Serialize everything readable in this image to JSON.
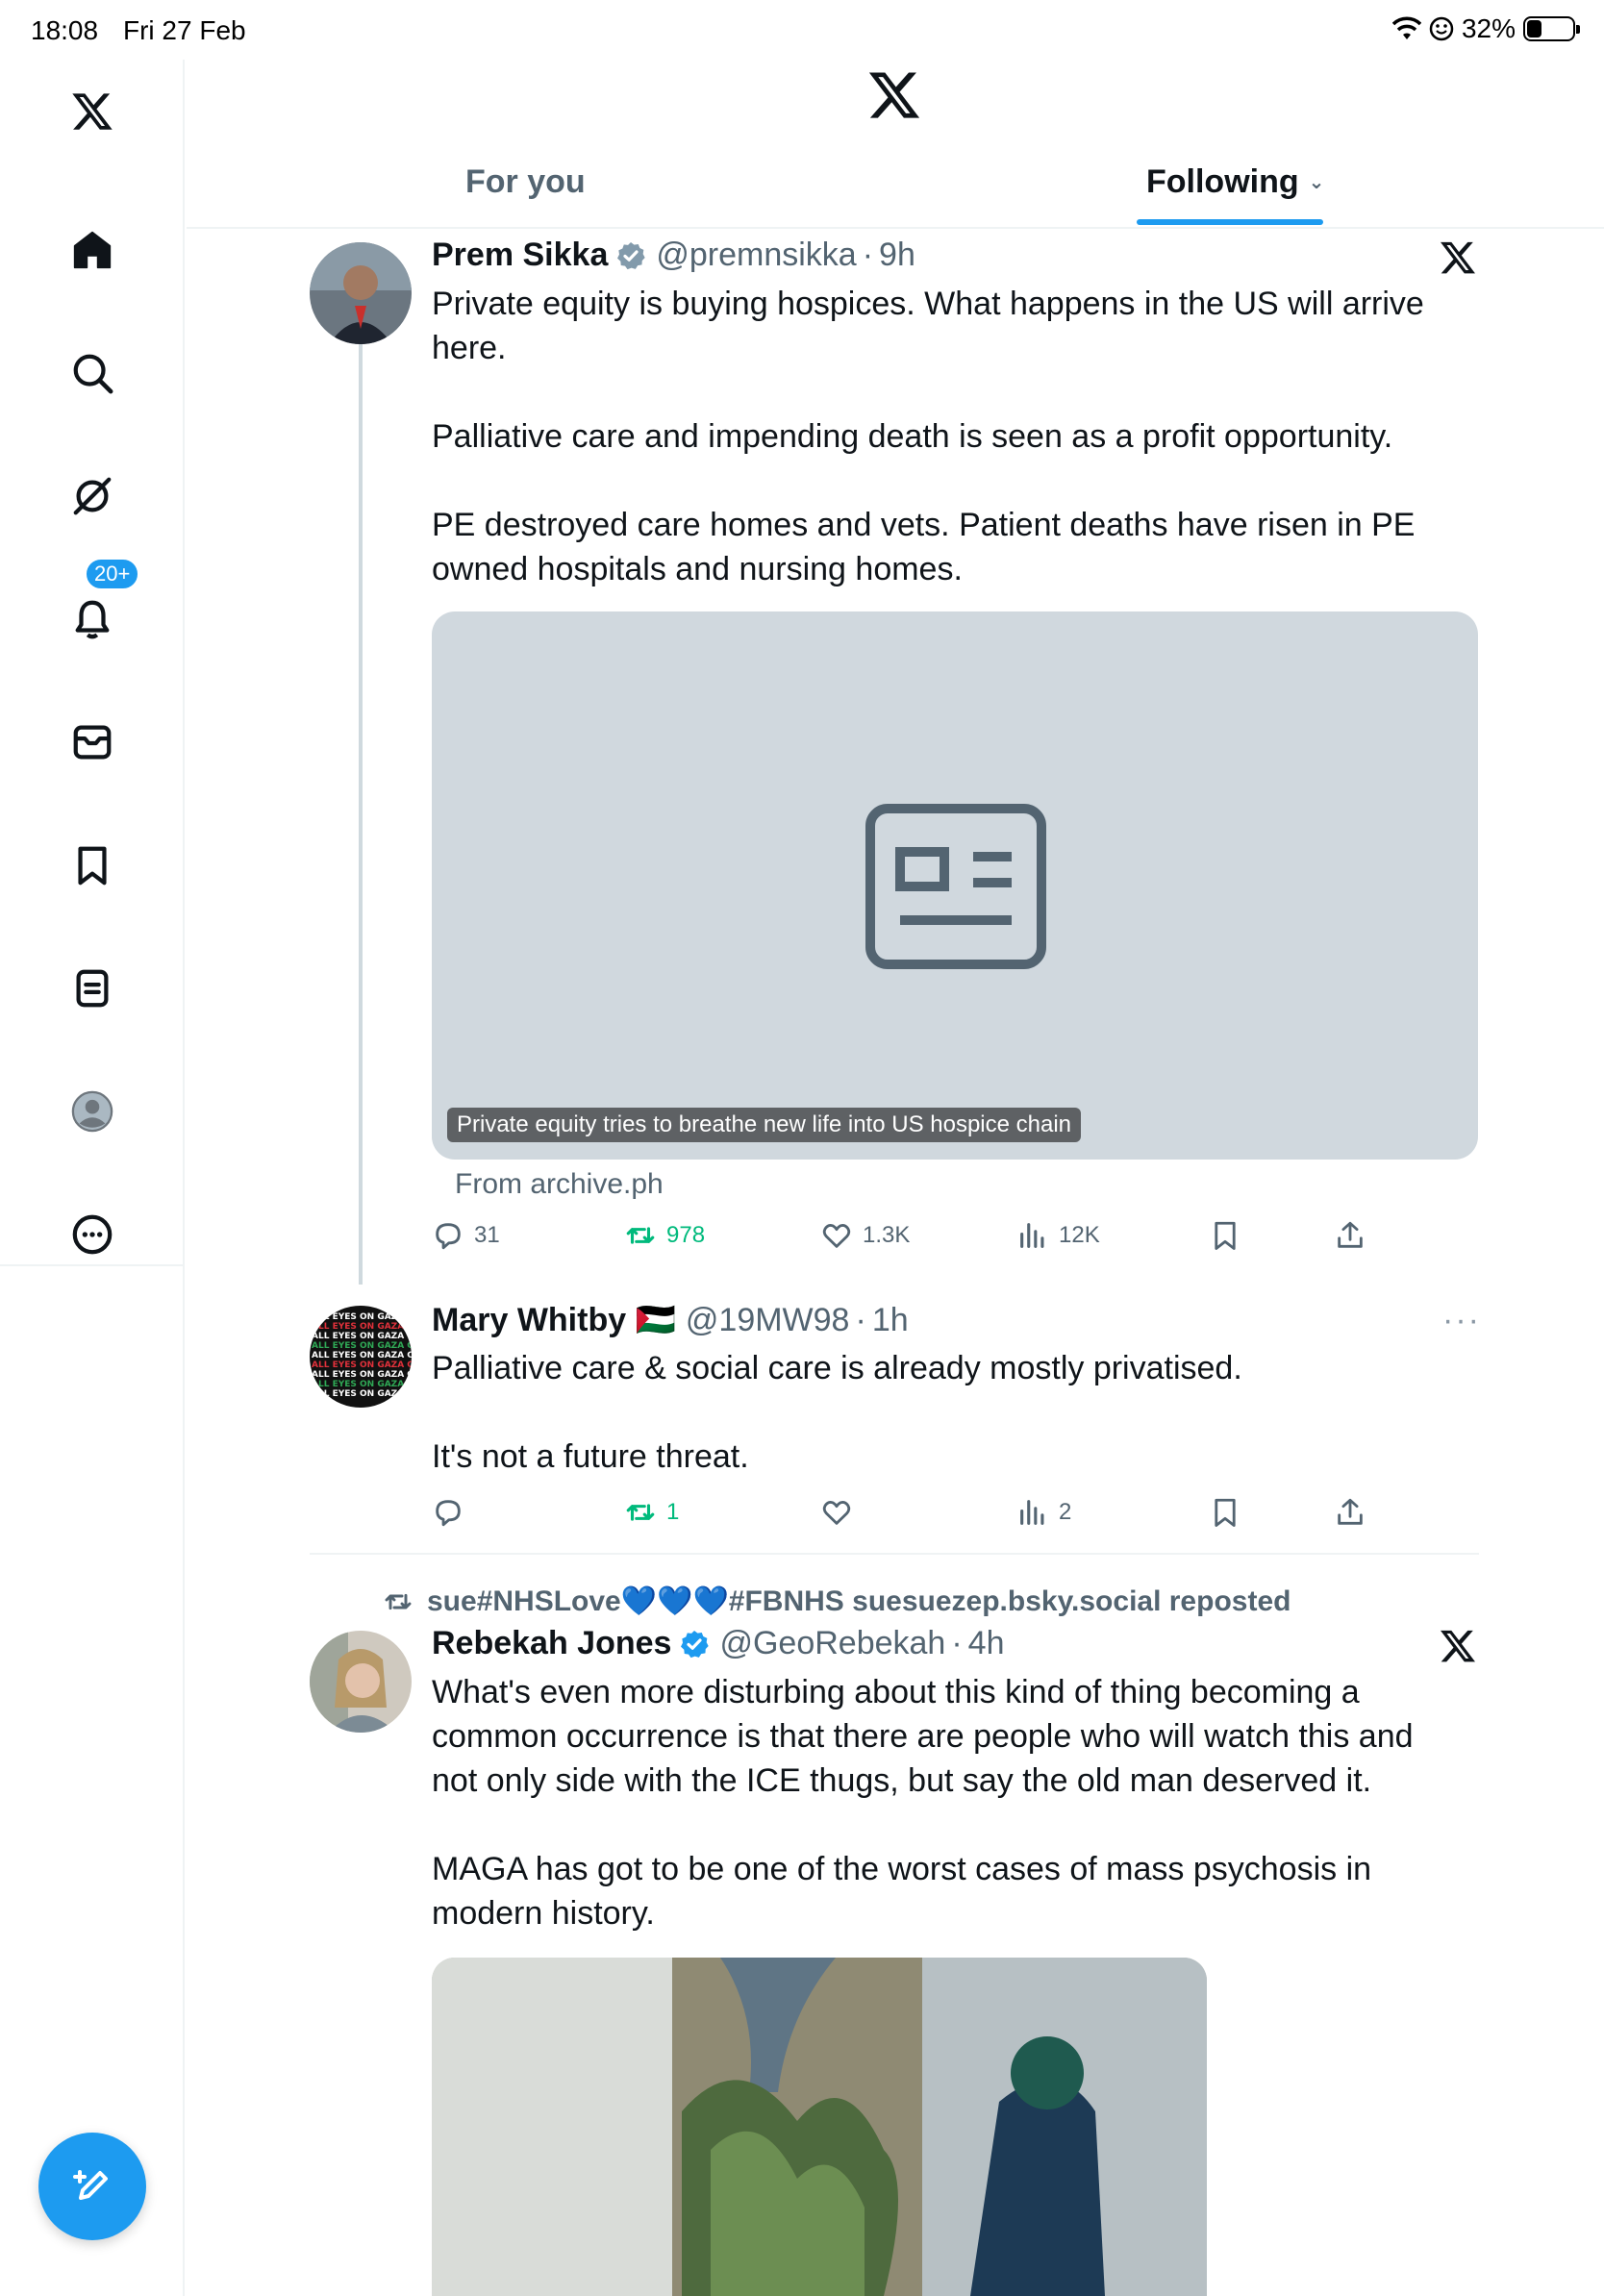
{
  "status_bar": {
    "time": "18:08",
    "date": "Fri 27 Feb",
    "battery": "32%",
    "battery_level": 0.32
  },
  "sidebar": {
    "notifications_badge": "20+",
    "items": [
      "x-logo",
      "home",
      "search",
      "grok",
      "notifications",
      "messages",
      "bookmarks",
      "lists",
      "profile",
      "more"
    ]
  },
  "tabs": [
    {
      "label": "For you",
      "selected": false
    },
    {
      "label": "Following",
      "selected": true
    }
  ],
  "tweets": [
    {
      "name": "Prem Sikka",
      "handle": "@premnsikka",
      "time": "9h",
      "text": "Private equity is buying hospices. What happens in the US will arrive\nhere.\n\nPalliative care and impending death is seen as a profit opportunity.\n\nPE destroyed care homes and vets. Patient deaths have risen in PE\nowned hospitals and nursing homes.",
      "card": {
        "caption": "Private equity tries to breathe new life into US hospice chain",
        "source": "From archive.ph"
      },
      "actions": {
        "replies": "31",
        "reposts": "978",
        "likes": "1.3K",
        "views": "12K"
      }
    },
    {
      "name": "Mary Whitby 🇵🇸",
      "handle": "@19MW98",
      "time": "1h",
      "text": "Palliative care & social care is already mostly privatised.\n\nIt's not a future threat.",
      "actions": {
        "replies": "",
        "reposts": "1",
        "likes": "",
        "views": "2"
      }
    },
    {
      "repost_label": "sue#NHSLove💙💙💙#FBNHS suesuezep.bsky.social reposted",
      "name": "Rebekah Jones",
      "handle": "@GeoRebekah",
      "time": "4h",
      "text": "What's even more disturbing about this kind of thing becoming a\ncommon occurrence is that there are people who will watch this and\nnot only side with the ICE thugs, but say the old man deserved it.\n\nMAGA has got to be one of the worst cases of mass psychosis in\nmodern history."
    }
  ],
  "colors": {
    "accent": "#1d9bf0",
    "repost_green": "#00ba7c",
    "muted": "#536471"
  }
}
